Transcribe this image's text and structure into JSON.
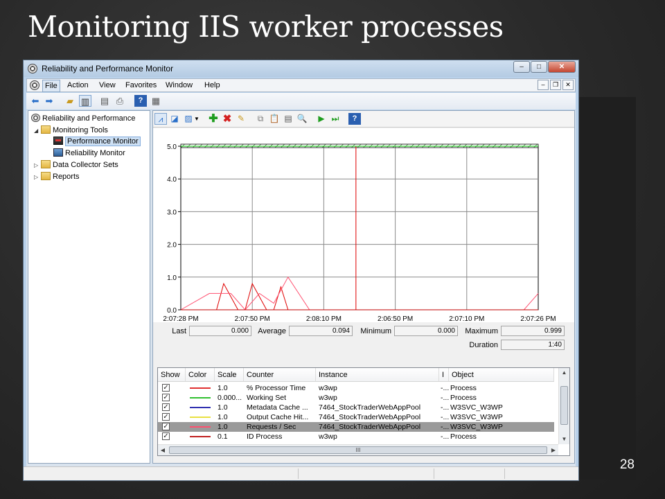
{
  "slide": {
    "title": "Monitoring IIS worker processes",
    "number": "28"
  },
  "window": {
    "title": "Reliability and Performance Monitor",
    "caption_buttons": {
      "minimize": "–",
      "maximize": "□",
      "close": "✕"
    }
  },
  "menu": {
    "items": [
      "File",
      "Action",
      "View",
      "Favorites",
      "Window",
      "Help"
    ],
    "mdi_buttons": [
      "–",
      "❐",
      "✕"
    ]
  },
  "toolbar": {
    "icons": [
      "back-arrow-icon",
      "forward-arrow-icon",
      "up-folder-icon",
      "show-hide-tree-icon",
      "properties-icon",
      "print-icon",
      "help-icon",
      "console-icon"
    ]
  },
  "tree": {
    "items": [
      {
        "label": "Reliability and Performance",
        "icon": "gauge-icon"
      },
      {
        "label": "Monitoring Tools",
        "icon": "folder-icon"
      },
      {
        "label": "Performance Monitor",
        "icon": "performance-monitor-icon"
      },
      {
        "label": "Reliability Monitor",
        "icon": "reliability-monitor-icon"
      },
      {
        "label": "Data Collector Sets",
        "icon": "data-collector-icon"
      },
      {
        "label": "Reports",
        "icon": "reports-icon"
      }
    ]
  },
  "content_toolbar": {
    "icons": [
      "view-graph-icon",
      "view-current-activity-icon",
      "change-graph-type-icon",
      "dropdown-icon",
      "add-counter-icon",
      "delete-counter-icon",
      "highlight-icon",
      "copy-properties-icon",
      "paste-counter-list-icon",
      "properties-icon",
      "zoom-icon",
      "unfreeze-display-icon",
      "update-data-icon",
      "help-icon"
    ]
  },
  "chart_data": {
    "type": "line",
    "ylim": [
      0,
      5
    ],
    "yticks": [
      "5.0",
      "4.0",
      "3.0",
      "2.0",
      "1.0",
      "0.0"
    ],
    "xticks": [
      "2:07:28 PM",
      "2:07:50 PM",
      "2:08:10 PM",
      "2:06:50 PM",
      "2:07:10 PM",
      "2:07:26 PM"
    ],
    "grid": true,
    "series": [
      {
        "color": "#e00000",
        "x": [
          0,
          0.1,
          0.2,
          0.4,
          0.5,
          0.6,
          0.8,
          0.9,
          1.0,
          1.2,
          1.3,
          1.4,
          1.5,
          2.4,
          2.45,
          2.45,
          5.0
        ],
        "y": [
          0,
          0,
          0,
          0,
          0,
          0.8,
          0,
          0,
          0.8,
          0,
          0,
          0.7,
          0,
          0,
          0,
          5.0,
          5.0
        ]
      },
      {
        "color": "#00c000",
        "x": [
          0,
          5.0
        ],
        "y": [
          5.0,
          5.0
        ]
      },
      {
        "color": "#1010c0",
        "x": [
          0,
          5.0
        ],
        "y": [
          0,
          0
        ]
      },
      {
        "color": "#e8e800",
        "x": [
          0,
          5.0
        ],
        "y": [
          0,
          0
        ]
      },
      {
        "color": "#ff5070",
        "x": [
          0,
          0.4,
          0.7,
          0.9,
          1.1,
          1.3,
          1.5,
          1.8,
          4.8,
          5.0
        ],
        "y": [
          0,
          0.5,
          0.5,
          0,
          0.5,
          0.2,
          1.0,
          0,
          0,
          0.5
        ]
      },
      {
        "color": "#c00000",
        "x": [
          0,
          2.45,
          2.45,
          5.0
        ],
        "y": [
          0,
          0,
          0,
          0
        ]
      }
    ]
  },
  "stats": {
    "last_label": "Last",
    "last_value": "0.000",
    "average_label": "Average",
    "average_value": "0.094",
    "minimum_label": "Minimum",
    "minimum_value": "0.000",
    "maximum_label": "Maximum",
    "maximum_value": "0.999",
    "duration_label": "Duration",
    "duration_value": "1:40"
  },
  "counter_table": {
    "headers": [
      "Show",
      "Color",
      "Scale",
      "Counter",
      "Instance",
      "I",
      "Object"
    ],
    "rows": [
      {
        "show": "✓",
        "color": "#e03030",
        "scale": "1.0",
        "counter": "% Processor Time",
        "instance": "w3wp",
        "parent": "-...",
        "object": "Process"
      },
      {
        "show": "✓",
        "color": "#30c030",
        "scale": "0.000...",
        "counter": "Working Set",
        "instance": "w3wp",
        "parent": "-...",
        "object": "Process"
      },
      {
        "show": "✓",
        "color": "#3030b0",
        "scale": "1.0",
        "counter": "Metadata Cache ...",
        "instance": "7464_StockTraderWebAppPool",
        "parent": "-...",
        "object": "W3SVC_W3WP"
      },
      {
        "show": "✓",
        "color": "#e8e040",
        "scale": "1.0",
        "counter": "Output Cache Hit...",
        "instance": "7464_StockTraderWebAppPool",
        "parent": "-...",
        "object": "W3SVC_W3WP"
      },
      {
        "show": "✓",
        "color": "#ff5070",
        "scale": "1.0",
        "counter": "Requests / Sec",
        "instance": "7464_StockTraderWebAppPool",
        "parent": "-...",
        "object": "W3SVC_W3WP"
      },
      {
        "show": "✓",
        "color": "#c02020",
        "scale": "0.1",
        "counter": "ID Process",
        "instance": "w3wp",
        "parent": "-...",
        "object": "Process"
      }
    ],
    "selected_row": 4
  },
  "scrollbar": {
    "up": "▲",
    "down": "▼",
    "left": "◀",
    "right": "▶",
    "grip": "III"
  }
}
